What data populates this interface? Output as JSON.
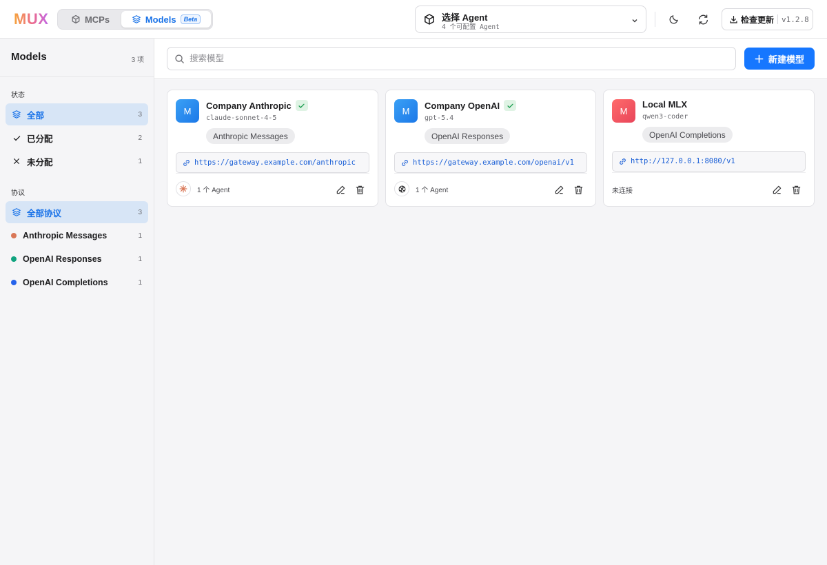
{
  "app": {
    "logo": "MUX",
    "tabs": [
      {
        "label": "MCPs"
      },
      {
        "label": "Models",
        "badge": "Beta"
      }
    ],
    "agent_selector": {
      "title": "选择 Agent",
      "subtitle": "4 个可配置 Agent"
    },
    "update": {
      "label": "检查更新",
      "version": "v1.2.8"
    }
  },
  "sidebar": {
    "title": "Models",
    "count": "3 项",
    "status_section": "状态",
    "status_items": [
      {
        "label": "全部",
        "count": "3",
        "icon": "layers-icon",
        "active": true
      },
      {
        "label": "已分配",
        "count": "2",
        "icon": "check-icon",
        "active": false
      },
      {
        "label": "未分配",
        "count": "1",
        "icon": "x-icon",
        "active": false
      }
    ],
    "protocol_section": "协议",
    "protocol_items": [
      {
        "label": "全部协议",
        "count": "3",
        "icon": "layers-icon",
        "active": true
      },
      {
        "label": "Anthropic Messages",
        "count": "1",
        "color": "#d97757"
      },
      {
        "label": "OpenAI Responses",
        "count": "1",
        "color": "#10a37f"
      },
      {
        "label": "OpenAI Completions",
        "count": "1",
        "color": "#2563eb"
      }
    ]
  },
  "search": {
    "placeholder": "搜索模型"
  },
  "new_button": {
    "label": "新建模型"
  },
  "models": [
    {
      "avatar": "M",
      "name": "Company Anthropic",
      "model": "claude-sonnet-4-5",
      "protocol": "Anthropic Messages",
      "url": "https://gateway.example.com/anthropic",
      "agent_text": "1 个 Agent",
      "agent_icon": "anthropic-icon",
      "verified": true
    },
    {
      "avatar": "M",
      "name": "Company OpenAI",
      "model": "gpt-5.4",
      "protocol": "OpenAI Responses",
      "url": "https://gateway.example.com/openai/v1",
      "agent_text": "1 个 Agent",
      "agent_icon": "openai-icon",
      "verified": true
    },
    {
      "avatar": "M",
      "name": "Local MLX",
      "model": "qwen3-coder",
      "protocol": "OpenAI Completions",
      "url": "http://127.0.0.1:8080/v1",
      "agent_text": "未连接",
      "verified": false
    }
  ]
}
